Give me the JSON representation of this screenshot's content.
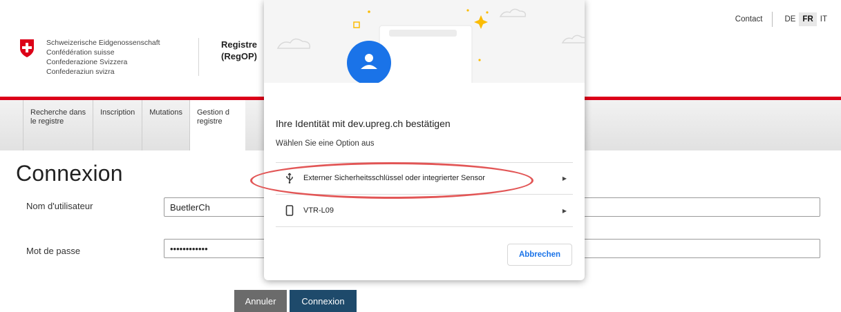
{
  "header": {
    "confederation": [
      "Schweizerische Eidgenossenschaft",
      "Confédération suisse",
      "Confederazione Svizzera",
      "Confederaziun svizra"
    ],
    "app_title": [
      "Registre",
      "(RegOP)"
    ],
    "contact_label": "Contact",
    "languages": [
      {
        "code": "DE",
        "active": false
      },
      {
        "code": "FR",
        "active": true
      },
      {
        "code": "IT",
        "active": false
      }
    ]
  },
  "nav": {
    "items": [
      {
        "label": [
          "Recherche dans",
          "le registre"
        ]
      },
      {
        "label": [
          "Inscription"
        ]
      },
      {
        "label": [
          "Mutations"
        ]
      },
      {
        "label": [
          "Gestion d",
          "registre"
        ]
      }
    ]
  },
  "login": {
    "title": "Connexion",
    "username_label": "Nom d'utilisateur",
    "username_value": "BuetlerCh",
    "password_label": "Mot de passe",
    "password_value": "••••••••••••",
    "cancel_label": "Annuler",
    "submit_label": "Connexion"
  },
  "dialog": {
    "title": "Ihre Identität mit dev.upreg.ch bestätigen",
    "subtitle": "Wählen Sie eine Option aus",
    "options": [
      {
        "label": "Externer Sicherheitsschlüssel oder integrierter Sensor",
        "icon": "usb-icon"
      },
      {
        "label": "VTR-L09",
        "icon": "phone-icon"
      }
    ],
    "cancel_label": "Abbrechen",
    "accent_color": "#1a73e8",
    "avatar_color": "#1a73e8"
  },
  "colors": {
    "swiss_red": "#dc0018",
    "highlight": "#e25656",
    "submit_button": "#1e4a6b",
    "cancel_button": "#6b6b6b"
  }
}
